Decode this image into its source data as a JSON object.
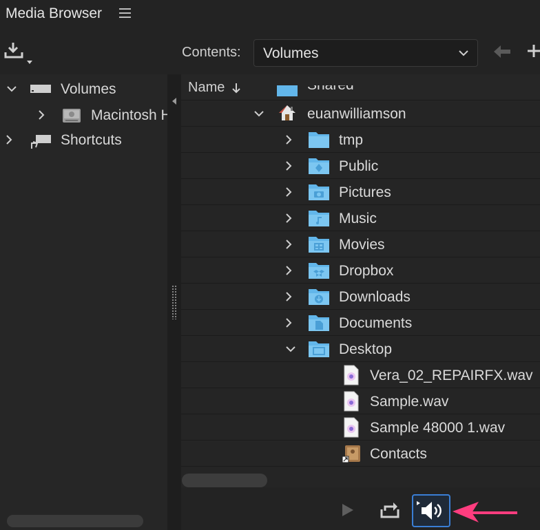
{
  "panel": {
    "title": "Media Browser"
  },
  "toolbar": {
    "contents_label": "Contents:",
    "contents_value": "Volumes"
  },
  "left_tree": [
    {
      "label": "Volumes",
      "icon": "drive-icon",
      "expanded": true
    },
    {
      "label": "Macintosh HD",
      "icon": "hard-disk-icon",
      "expanded": false
    },
    {
      "label": "Shortcuts",
      "icon": "shortcut-icon",
      "expanded": false
    }
  ],
  "list": {
    "column_header": "Name",
    "sort": "descending",
    "partial_top": "Shared",
    "items": [
      {
        "label": "euanwilliamson",
        "icon": "home-icon",
        "level": 1,
        "chevron": "down"
      },
      {
        "label": "tmp",
        "icon": "folder-icon",
        "level": 2,
        "chevron": "right"
      },
      {
        "label": "Public",
        "icon": "folder-public-icon",
        "level": 2,
        "chevron": "right"
      },
      {
        "label": "Pictures",
        "icon": "folder-pictures-icon",
        "level": 2,
        "chevron": "right"
      },
      {
        "label": "Music",
        "icon": "folder-music-icon",
        "level": 2,
        "chevron": "right"
      },
      {
        "label": "Movies",
        "icon": "folder-movies-icon",
        "level": 2,
        "chevron": "right"
      },
      {
        "label": "Dropbox",
        "icon": "folder-dropbox-icon",
        "level": 2,
        "chevron": "right"
      },
      {
        "label": "Downloads",
        "icon": "folder-downloads-icon",
        "level": 2,
        "chevron": "right"
      },
      {
        "label": "Documents",
        "icon": "folder-documents-icon",
        "level": 2,
        "chevron": "right"
      },
      {
        "label": "Desktop",
        "icon": "folder-desktop-icon",
        "level": 2,
        "chevron": "down"
      },
      {
        "label": "Vera_02_REPAIRFX.wav",
        "icon": "audio-file-icon",
        "level": 3,
        "chevron": "none"
      },
      {
        "label": "Sample.wav",
        "icon": "audio-file-icon",
        "level": 3,
        "chevron": "none"
      },
      {
        "label": "Sample 48000 1.wav",
        "icon": "audio-file-icon",
        "level": 3,
        "chevron": "none"
      },
      {
        "label": "Contacts",
        "icon": "contacts-alias-icon",
        "level": 3,
        "chevron": "none"
      }
    ]
  },
  "bottom_toolbar": {
    "play": "play-icon",
    "loop": "loop-icon",
    "audio": "audio-scrubbing-icon",
    "audio_active": true
  },
  "colors": {
    "folder": "#62b6ea",
    "accent": "#3a7fd6",
    "annotation": "#ff3d7f"
  }
}
